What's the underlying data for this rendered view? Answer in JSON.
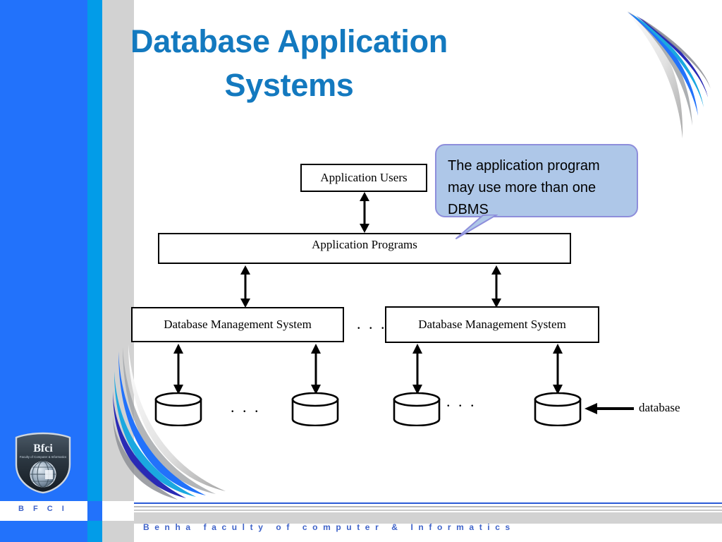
{
  "slide": {
    "title_line1": "Database Application",
    "title_line2": "Systems",
    "title_color": "#1379bf",
    "background_color": "#ffffff"
  },
  "theme": {
    "band_royal_blue": "#2272fb",
    "band_cyan": "#029ce8",
    "band_gray": "#d2d2d2",
    "callout_fill": "#aec7e8",
    "callout_border": "#8e8edb",
    "footer_text_color": "#3f63c9",
    "diagram_stroke": "#000000"
  },
  "callout": {
    "text": "The application program may use more than one DBMS"
  },
  "diagram": {
    "application_users": "Application Users",
    "application_programs": "Application Programs",
    "dbms_left": "Database Management System",
    "dbms_right": "Database Management System",
    "dbms_separator": ". . .",
    "db_separator_left": ". . .",
    "db_separator_right": ". . .",
    "database_label": "database"
  },
  "logo": {
    "brand": "Bfci",
    "tagline": "Faculty of Computer & Informatics"
  },
  "footer": {
    "abbrev": "B F C I",
    "institution": "Benha  faculty  of  computer  &  Informatics"
  }
}
